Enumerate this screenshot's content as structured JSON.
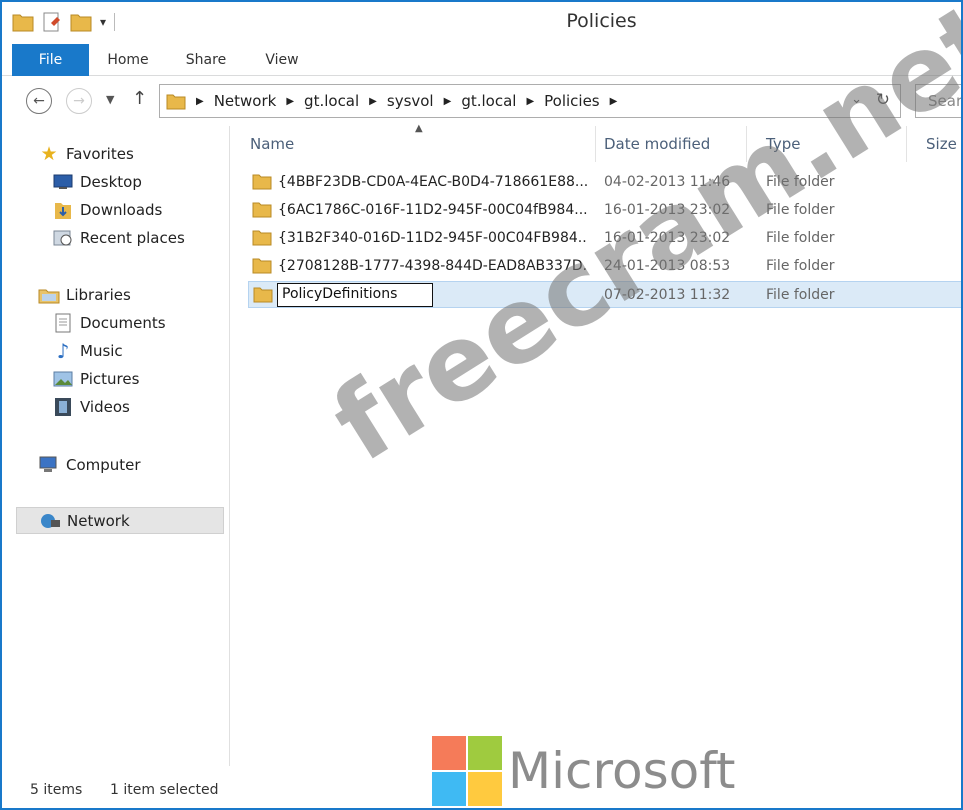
{
  "window": {
    "title": "Policies"
  },
  "ribbon": {
    "tabs": [
      "File",
      "Home",
      "Share",
      "View"
    ]
  },
  "address": {
    "path": [
      "Network",
      "gt.local",
      "sysvol",
      "gt.local",
      "Policies"
    ],
    "search_placeholder": "Search"
  },
  "nav_pane": {
    "favorites": {
      "label": "Favorites",
      "items": [
        "Desktop",
        "Downloads",
        "Recent places"
      ]
    },
    "libraries": {
      "label": "Libraries",
      "items": [
        "Documents",
        "Music",
        "Pictures",
        "Videos"
      ]
    },
    "computer": "Computer",
    "network": "Network"
  },
  "columns": [
    "Name",
    "Date modified",
    "Type",
    "Size"
  ],
  "files": [
    {
      "name": "{4BBF23DB-CD0A-4EAC-B0D4-718661E88...",
      "date": "04-02-2013 11:46",
      "type": "File folder"
    },
    {
      "name": "{6AC1786C-016F-11D2-945F-00C04fB984...",
      "date": "16-01-2013 23:02",
      "type": "File folder"
    },
    {
      "name": "{31B2F340-016D-11D2-945F-00C04FB984...",
      "date": "16-01-2013 23:02",
      "type": "File folder"
    },
    {
      "name": "{2708128B-1777-4398-844D-EAD8AB337D...",
      "date": "24-01-2013 08:53",
      "type": "File folder"
    },
    {
      "name": "PolicyDefinitions",
      "date": "07-02-2013 11:32",
      "type": "File folder"
    }
  ],
  "status": {
    "count": "5 items",
    "selection": "1 item selected"
  },
  "watermark": "freecram.net",
  "logo": "Microsoft",
  "colors": {
    "accent": "#1979ca",
    "selection": "#dbeaf7",
    "folder": "#e8b84a"
  }
}
